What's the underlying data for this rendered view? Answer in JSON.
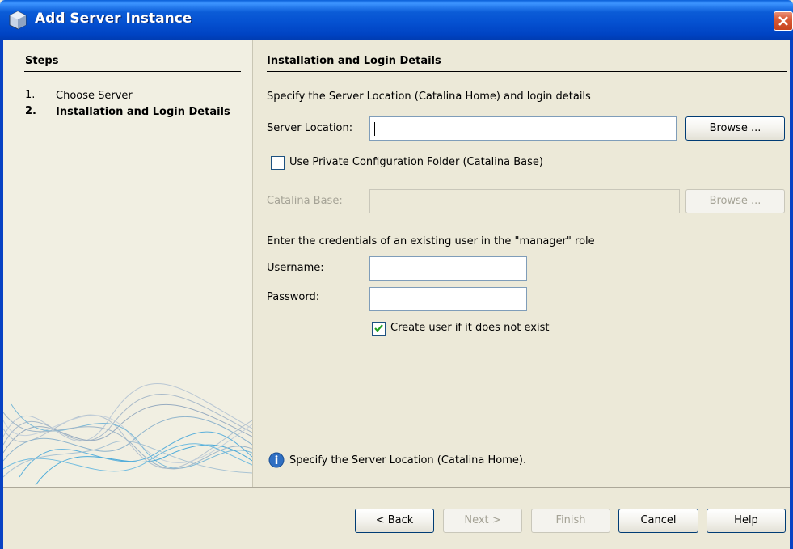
{
  "window": {
    "title": "Add Server Instance",
    "icon": "cube-icon",
    "close_icon": "close-icon"
  },
  "steps": {
    "title": "Steps",
    "items": [
      {
        "num": "1.",
        "label": "Choose Server",
        "active": false
      },
      {
        "num": "2.",
        "label": "Installation and Login Details",
        "active": true
      }
    ]
  },
  "content": {
    "section_title": "Installation and Login Details",
    "intro": "Specify the Server Location (Catalina Home) and login details",
    "server_location_label": "Server Location:",
    "server_location_value": "",
    "browse_label": "Browse ...",
    "use_private_config_label": "Use Private Configuration Folder (Catalina Base)",
    "use_private_config_checked": false,
    "catalina_base_label": "Catalina Base:",
    "catalina_base_value": "",
    "browse2_label": "Browse ...",
    "credentials_text": "Enter the credentials of an existing user in the \"manager\" role",
    "username_label": "Username:",
    "username_value": "",
    "password_label": "Password:",
    "password_value": "",
    "create_user_label": "Create user if it does not exist",
    "create_user_checked": true,
    "info_message": "Specify the Server Location (Catalina Home)."
  },
  "buttons": {
    "back": "< Back",
    "next": "Next >",
    "finish": "Finish",
    "cancel": "Cancel",
    "help": "Help"
  },
  "colors": {
    "titlebar": "#0551d1",
    "window_bg": "#ece9d8",
    "steps_bg": "#f1efe2",
    "disabled_text": "#a5a396",
    "check_green": "#21a121"
  }
}
